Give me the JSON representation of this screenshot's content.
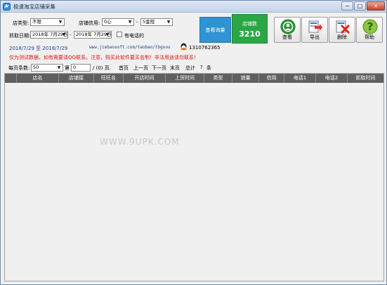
{
  "window": {
    "title": "极速淘宝店铺采集",
    "min": "0",
    "max": "1",
    "close": "r"
  },
  "filters": {
    "shop_type_label": "店类型:",
    "shop_type_value": "不限",
    "credit_label": "店铺信用:",
    "credit_from": "0心",
    "credit_sep": "-",
    "credit_to": "5金冠",
    "date_label": "抓取日期:",
    "date_from": "2018年 7月29日",
    "date_sep": "-",
    "date_to": "2018年 7月29日",
    "has_phone_label": "有电话的"
  },
  "actions": {
    "query_label": "查看询量",
    "count_label": "店铺数",
    "count_value": "3210",
    "buttons": [
      {
        "label": "查看",
        "icon": "target-icon"
      },
      {
        "label": "导出",
        "icon": "export-icon"
      },
      {
        "label": "删除",
        "icon": "delete-icon"
      },
      {
        "label": "帮助",
        "icon": "help-icon"
      }
    ]
  },
  "info": {
    "date_range": "2018/7/29  至  2018/7/29",
    "url": "www.jiebaosoft.com/taobao/tbgsou",
    "qq": "1310762365",
    "warning": "仅为测试数据，如有需要请QQ联系。注意，购买此软件要买名制！非法用途请勿联系！"
  },
  "pager": {
    "page_size_label": "每页条数:",
    "page_size_value": "50",
    "page_label": "第",
    "page_value": "0",
    "total_pages": "/  (0) 页.",
    "first": "首页",
    "prev": "上一页",
    "next": "下一页",
    "last": "末页",
    "total_label": "总计",
    "total_value": "?",
    "total_unit": "条"
  },
  "table": {
    "columns": [
      "店名",
      "店铺接",
      "旺旺名",
      "开店时间",
      "上货时间",
      "类型",
      "销量",
      "信用",
      "电话1",
      "电话2",
      "抓取时间"
    ]
  },
  "watermark": "WWW.9UPK.COM"
}
